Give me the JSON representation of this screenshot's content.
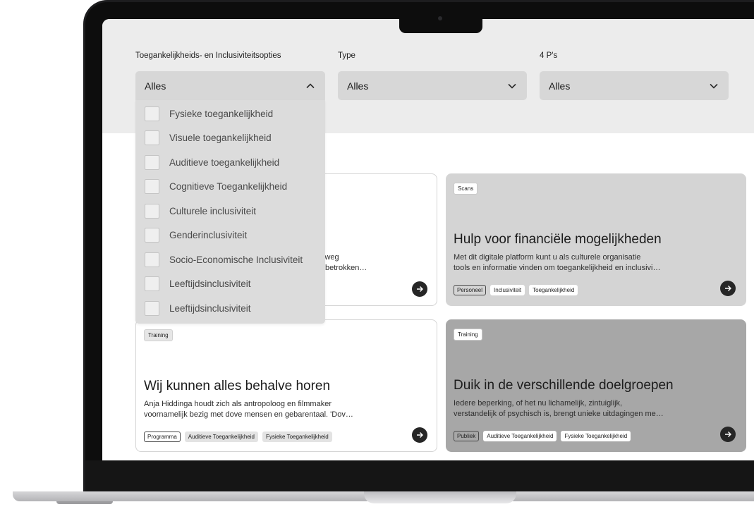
{
  "filters": {
    "accessibility": {
      "label": "Toegankelijkheids- en Inclusiviteitsopties",
      "value": "Alles",
      "open": true
    },
    "type": {
      "label": "Type",
      "value": "Alles"
    },
    "four_p": {
      "label": "4 P's",
      "value": "Alles"
    }
  },
  "dropdown_options": [
    "Fysieke toegankelijkheid",
    "Visuele toegankelijkheid",
    "Auditieve toegankelijkheid",
    "Cognitieve Toegankelijkheid",
    "Culturele inclusiviteit",
    "Genderinclusiviteit",
    "Socio-Economische Inclusiviteit",
    "Leeftijdsinclusiviteit",
    "Leeftijdsinclusiviteit"
  ],
  "cards": [
    {
      "visible_fragment_line1": "lweg",
      "visible_fragment_line2": "betrokken…"
    },
    {
      "category": "Scans",
      "title": "Hulp voor financiële mogelijkheden",
      "description_line1": "Met dit digitale platform kunt u als culturele organisatie",
      "description_line2": "tools en informatie vinden om toegankelijkheid en inclusivi…",
      "tags": [
        "Personeel",
        "Inclusiviteit",
        "Toegankelijkheid"
      ]
    },
    {
      "category": "Training",
      "title": "Wij kunnen alles behalve horen",
      "description_line1": "Anja Hiddinga houdt zich als antropoloog en filmmaker",
      "description_line2": "voornamelijk bezig met dove mensen en gebarentaal. 'Dov…",
      "tags": [
        "Programma",
        "Auditieve Toegankelijkheid",
        "Fysieke Toegankelijkheid"
      ]
    },
    {
      "category": "Training",
      "title": "Duik in de verschillende doelgroepen",
      "description_line1": "Iedere beperking, of het nu lichamelijk, zintuiglijk,",
      "description_line2": "verstandelijk of psychisch is, brengt unieke uitdagingen me…",
      "tags": [
        "Publiek",
        "Auditieve Toegankelijkheid",
        "Fysieke Toegankelijkheid"
      ]
    }
  ],
  "icons": {
    "chevron_up": "chevron-up-icon",
    "chevron_down": "chevron-down-icon",
    "arrow_right": "arrow-right-icon"
  }
}
